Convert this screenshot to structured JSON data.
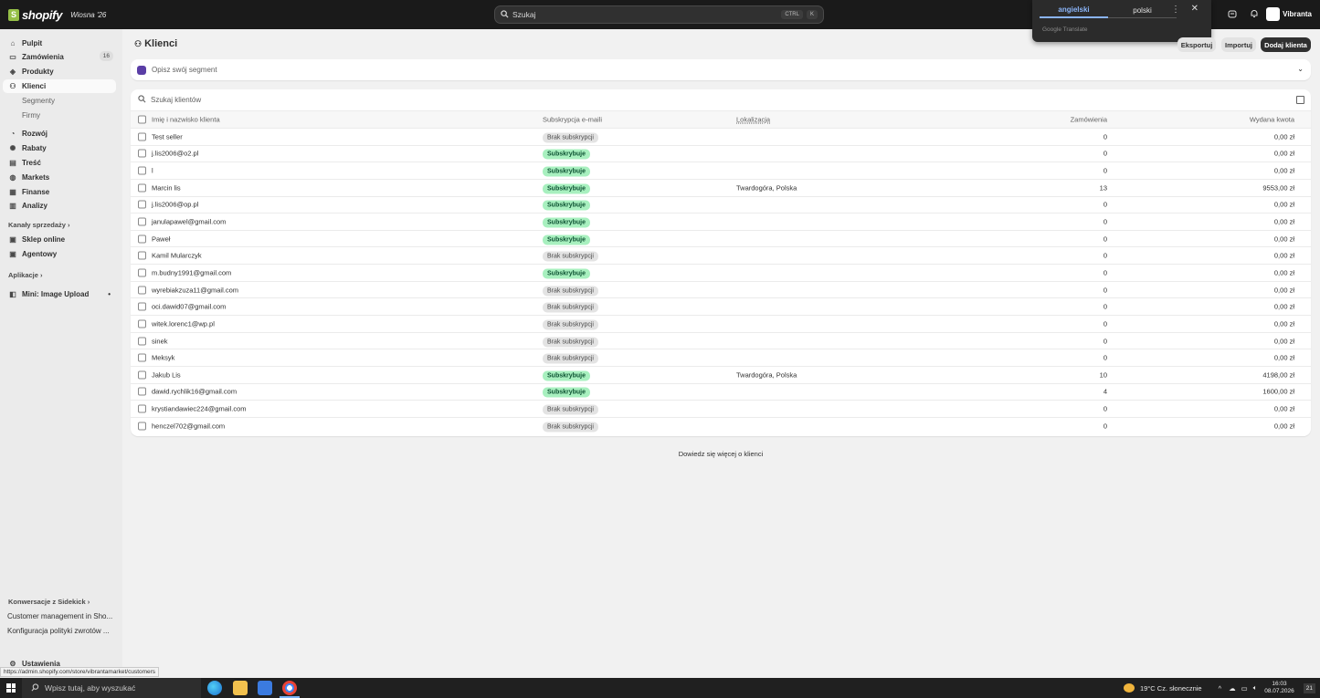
{
  "topbar": {
    "brand": "shopify",
    "edition": "Wiosna '26",
    "search_placeholder": "Szukaj",
    "kbd1": "CTRL",
    "kbd2": "K",
    "store_name": "Vibranta"
  },
  "translate": {
    "tab_active": "angielski",
    "tab_inactive": "polski",
    "footer": "Google Translate"
  },
  "sidebar": {
    "items": [
      {
        "label": "Pulpit",
        "icon": "home-icon"
      },
      {
        "label": "Zamówienia",
        "icon": "inbox-icon",
        "badge": "16"
      },
      {
        "label": "Produkty",
        "icon": "tag-icon"
      },
      {
        "label": "Klienci",
        "icon": "person-icon"
      },
      {
        "label": "Segmenty"
      },
      {
        "label": "Firmy"
      },
      {
        "label": "Rozwój",
        "icon": "growth-icon"
      },
      {
        "label": "Rabaty",
        "icon": "discount-icon"
      },
      {
        "label": "Treść",
        "icon": "content-icon"
      },
      {
        "label": "Markets",
        "icon": "globe-icon"
      },
      {
        "label": "Finanse",
        "icon": "bank-icon"
      },
      {
        "label": "Analizy",
        "icon": "chart-icon"
      }
    ],
    "sales_channels": "Kanały sprzedaży",
    "channels": [
      {
        "label": "Sklep online",
        "icon": "store-icon"
      },
      {
        "label": "Agentowy",
        "icon": "agent-icon"
      }
    ],
    "apps": "Aplikacje",
    "app_item": "Mini: Image Upload",
    "sidekick": "Konwersacje z Sidekick",
    "convo1": "Customer management in Sho...",
    "convo2": "Konfiguracja polityki zwrotów ...",
    "settings": "Ustawienia"
  },
  "main": {
    "title": "Klienci",
    "export": "Eksportuj",
    "import": "Importuj",
    "add": "Dodaj klienta",
    "segment_placeholder": "Opisz swój segment",
    "search_placeholder": "Szukaj klientów",
    "headers": {
      "name": "Imię i nazwisko klienta",
      "sub": "Subskrypcja e-maili",
      "loc": "Lokalizacja",
      "orders": "Zamówienia",
      "spent": "Wydana kwota"
    },
    "rows": [
      {
        "name": "Test seller",
        "sub": "Brak subskrypcji",
        "subscribed": false,
        "loc": "",
        "orders": "0",
        "spent": "0,00 zł"
      },
      {
        "name": "j.lis2006@o2.pl",
        "sub": "Subskrybuje",
        "subscribed": true,
        "loc": "",
        "orders": "0",
        "spent": "0,00 zł"
      },
      {
        "name": "l",
        "sub": "Subskrybuje",
        "subscribed": true,
        "loc": "",
        "orders": "0",
        "spent": "0,00 zł"
      },
      {
        "name": "Marcin lis",
        "sub": "Subskrybuje",
        "subscribed": true,
        "loc": "Twardogóra, Polska",
        "orders": "13",
        "spent": "9553,00 zł"
      },
      {
        "name": "j.lis2006@op.pl",
        "sub": "Subskrybuje",
        "subscribed": true,
        "loc": "",
        "orders": "0",
        "spent": "0,00 zł"
      },
      {
        "name": "janulapawel@gmail.com",
        "sub": "Subskrybuje",
        "subscribed": true,
        "loc": "",
        "orders": "0",
        "spent": "0,00 zł"
      },
      {
        "name": "Paweł",
        "sub": "Subskrybuje",
        "subscribed": true,
        "loc": "",
        "orders": "0",
        "spent": "0,00 zł"
      },
      {
        "name": "Kamil Mularczyk",
        "sub": "Brak subskrypcji",
        "subscribed": false,
        "loc": "",
        "orders": "0",
        "spent": "0,00 zł"
      },
      {
        "name": "m.budny1991@gmail.com",
        "sub": "Subskrybuje",
        "subscribed": true,
        "loc": "",
        "orders": "0",
        "spent": "0,00 zł"
      },
      {
        "name": "wyrebiakzuza11@gmail.com",
        "sub": "Brak subskrypcji",
        "subscribed": false,
        "loc": "",
        "orders": "0",
        "spent": "0,00 zł"
      },
      {
        "name": "oci.dawid07@gmail.com",
        "sub": "Brak subskrypcji",
        "subscribed": false,
        "loc": "",
        "orders": "0",
        "spent": "0,00 zł"
      },
      {
        "name": "witek.lorenc1@wp.pl",
        "sub": "Brak subskrypcji",
        "subscribed": false,
        "loc": "",
        "orders": "0",
        "spent": "0,00 zł"
      },
      {
        "name": "sinek",
        "sub": "Brak subskrypcji",
        "subscribed": false,
        "loc": "",
        "orders": "0",
        "spent": "0,00 zł"
      },
      {
        "name": "Meksyk",
        "sub": "Brak subskrypcji",
        "subscribed": false,
        "loc": "",
        "orders": "0",
        "spent": "0,00 zł"
      },
      {
        "name": "Jakub Lis",
        "sub": "Subskrybuje",
        "subscribed": true,
        "loc": "Twardogóra, Polska",
        "orders": "10",
        "spent": "4198,00 zł"
      },
      {
        "name": "dawid.rychlik16@gmail.com",
        "sub": "Subskrybuje",
        "subscribed": true,
        "loc": "",
        "orders": "4",
        "spent": "1600,00 zł"
      },
      {
        "name": "krystiandawiec224@gmail.com",
        "sub": "Brak subskrypcji",
        "subscribed": false,
        "loc": "",
        "orders": "0",
        "spent": "0,00 zł"
      },
      {
        "name": "henczel702@gmail.com",
        "sub": "Brak subskrypcji",
        "subscribed": false,
        "loc": "",
        "orders": "0",
        "spent": "0,00 zł"
      }
    ],
    "learn_more": "Dowiedz się więcej o klienci"
  },
  "status_url": "https://admin.shopify.com/store/vibrantamarket/customers",
  "taskbar": {
    "search_placeholder": "Wpisz tutaj, aby wyszukać",
    "weather": "19°C  Cz. słonecznie",
    "time": "16:03",
    "date": "08.07.2026",
    "notifications": "21"
  },
  "colors": {
    "accent": "#1a1a1a",
    "subscribed_bg": "#a8f0bf",
    "unsubscribed_bg": "#e3e3e3"
  }
}
